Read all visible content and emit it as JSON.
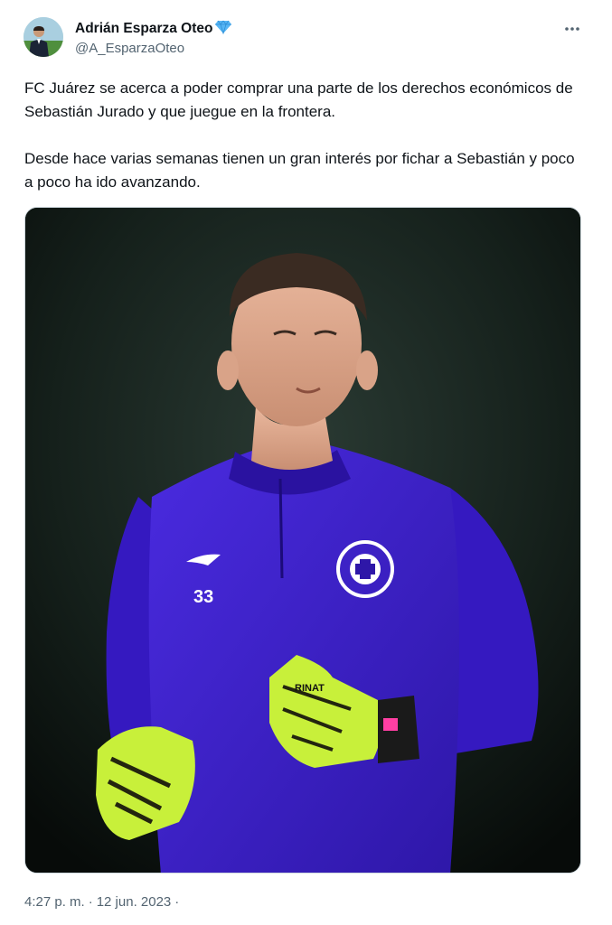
{
  "colors": {
    "text_primary": "#0f1419",
    "text_secondary": "#536471",
    "jersey": "#3b1fc7",
    "glove": "#c8f03a",
    "verified_badge": "#57b6f5"
  },
  "author": {
    "display_name": "Adrián Esparza Oteo",
    "verified_icon": "blue-diamond-icon",
    "handle": "@A_EsparzaOteo",
    "avatar_icon": "person-avatar"
  },
  "more_menu_icon": "more-horizontal-icon",
  "tweet": {
    "paragraphs": [
      "FC Juárez se acerca a poder comprar una parte de los derechos económicos de Sebastián Jurado y que juegue en la frontera.",
      "Desde hace varias semanas tienen un gran interés por fichar a Sebastián y poco a poco ha ido avanzando."
    ]
  },
  "media": {
    "kind": "photo",
    "jersey_number": "33",
    "glove_brand": "RINAT"
  },
  "meta": {
    "time": "4:27 p. m.",
    "separator": "·",
    "date": "12 jun. 2023",
    "trailing_separator": "·"
  }
}
